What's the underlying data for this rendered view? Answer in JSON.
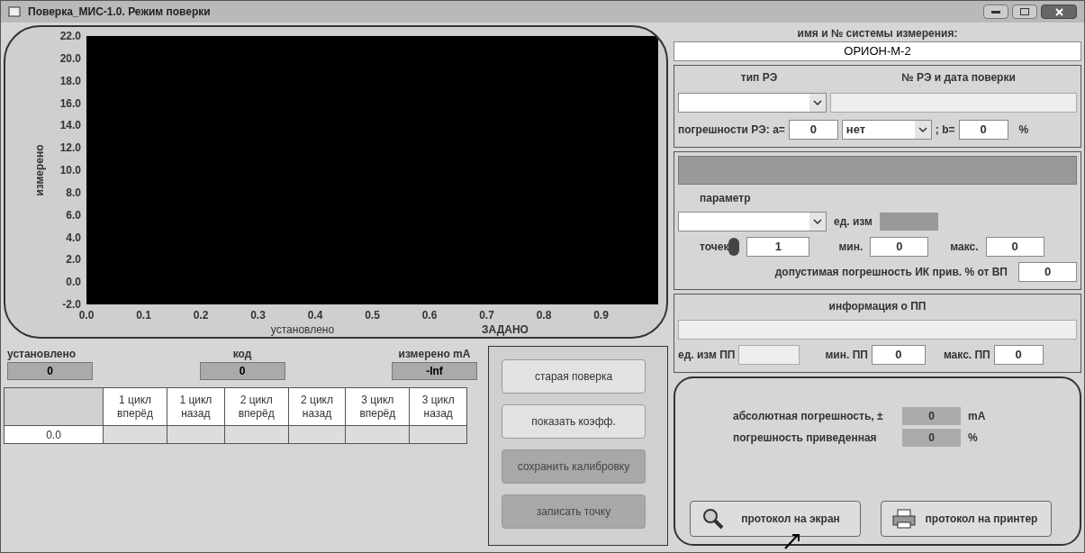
{
  "window": {
    "title": "Поверка_МИС-1.0. Режим поверки"
  },
  "chart": {
    "legend": "ЗАДАНО",
    "chart_data": {
      "type": "line",
      "xlabel": "установлено",
      "ylabel": "измерено",
      "xlim": [
        0,
        1
      ],
      "ylim": [
        -2,
        22
      ],
      "xticks": [
        {
          "value": 0,
          "label": "0.0"
        },
        {
          "value": 0.1,
          "label": "0.1"
        },
        {
          "value": 0.2,
          "label": "0.2"
        },
        {
          "value": 0.3,
          "label": "0.3"
        },
        {
          "value": 0.4,
          "label": "0.4"
        },
        {
          "value": 0.5,
          "label": "0.5"
        },
        {
          "value": 0.6,
          "label": "0.6"
        },
        {
          "value": 0.7,
          "label": "0.7"
        },
        {
          "value": 0.8,
          "label": "0.8"
        },
        {
          "value": 0.9,
          "label": "0.9"
        }
      ],
      "yticks": [
        {
          "value": -2,
          "label": "-2.0"
        },
        {
          "value": 0,
          "label": "0.0"
        },
        {
          "value": 2,
          "label": "2.0"
        },
        {
          "value": 4,
          "label": "4.0"
        },
        {
          "value": 6,
          "label": "6.0"
        },
        {
          "value": 8,
          "label": "8.0"
        },
        {
          "value": 10,
          "label": "10.0"
        },
        {
          "value": 12,
          "label": "12.0"
        },
        {
          "value": 14,
          "label": "14.0"
        },
        {
          "value": 16,
          "label": "16.0"
        },
        {
          "value": 18,
          "label": "18.0"
        },
        {
          "value": 20,
          "label": "20.0"
        },
        {
          "value": 22,
          "label": "22.0"
        }
      ]
    }
  },
  "readouts": [
    {
      "label": "установлено",
      "value": "0"
    },
    {
      "label": "код",
      "value": "0"
    },
    {
      "label": "измерено  mA",
      "value": "-Inf"
    }
  ],
  "table": {
    "columns": [
      "1 цикл вперёд",
      "1 цикл назад",
      "2 цикл вперёд",
      "2 цикл назад",
      "3 цикл вперёд",
      "3 цикл назад"
    ],
    "rows": [
      {
        "point": "0.0"
      }
    ]
  },
  "buttons": [
    {
      "label": "старая поверка",
      "disabled": false
    },
    {
      "label": "показать коэфф.",
      "disabled": false
    },
    {
      "label": "сохранить калибровку",
      "disabled": true
    },
    {
      "label": "записать точку",
      "disabled": true
    }
  ],
  "system": {
    "label": "имя и № системы измерения:",
    "value": "ОРИОН-М-2"
  },
  "re": {
    "type_label": "тип РЭ",
    "number_label": "№ РЭ и дата поверки",
    "errors_label": "погрешности РЭ: a=",
    "a": "0",
    "unit": "нет",
    "b_label": "; b=",
    "b": "0",
    "percent": "%"
  },
  "param": {
    "label": "параметр",
    "unit_label": "ед. изм",
    "points_label": "точек",
    "points": "1",
    "min_label": "мин.",
    "min": "0",
    "max_label": "макс.",
    "max": "0",
    "tolerance_label": "допустимая погрешность ИК прив. % от ВП",
    "tolerance": "0"
  },
  "pp": {
    "label": "информация о ПП",
    "unit_label": "ед. изм ПП",
    "min_label": "мин. ПП",
    "min": "0",
    "max_label": "макс. ПП",
    "max": "0"
  },
  "results": {
    "abs_label": "абсолютная погрешность,  ±",
    "abs": "0",
    "abs_unit": "mA",
    "red_label": "погрешность приведенная",
    "red": "0",
    "red_unit": "%",
    "buttons": [
      {
        "label": "протокол на экран",
        "kind": "screen"
      },
      {
        "label": "протокол на принтер",
        "kind": "printer"
      }
    ]
  }
}
